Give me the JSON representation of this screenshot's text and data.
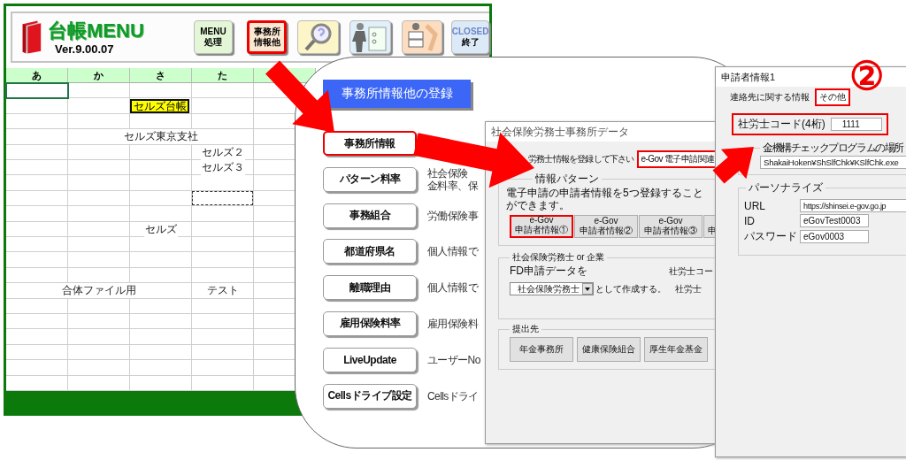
{
  "sheet": {
    "title": "台帳MENU",
    "version": "Ver.9.00.07",
    "toolbar": [
      {
        "kind": "text",
        "lines": [
          "MENU",
          "処理"
        ],
        "selected": false
      },
      {
        "kind": "text",
        "lines": [
          "事務所",
          "情報他"
        ],
        "selected": true
      },
      {
        "kind": "search",
        "selected": false
      },
      {
        "kind": "file",
        "selected": false
      },
      {
        "kind": "tool",
        "selected": false
      },
      {
        "kind": "closed",
        "lines": [
          "CLOSED",
          "終了"
        ],
        "selected": false
      }
    ],
    "columns": [
      "あ",
      "か",
      "さ",
      "た"
    ],
    "rows": [
      {
        "cells": [
          {
            "kind": "active"
          },
          null,
          null,
          null
        ]
      },
      {
        "cells": [
          null,
          null,
          {
            "kind": "highlight",
            "text": "セルズ台帳"
          },
          null
        ]
      },
      {
        "cells": [
          null,
          null,
          null,
          null
        ]
      },
      {
        "cells": [
          null,
          null,
          {
            "kind": "plain",
            "text": "セルズ東京支社"
          },
          null
        ]
      },
      {
        "cells": [
          null,
          null,
          null,
          {
            "kind": "plain",
            "text": "セルズ２"
          }
        ]
      },
      {
        "cells": [
          null,
          null,
          null,
          {
            "kind": "plain",
            "text": "セルズ３"
          }
        ]
      },
      {
        "cells": [
          null,
          null,
          null,
          null
        ]
      },
      {
        "cells": [
          null,
          null,
          null,
          {
            "kind": "marquee"
          }
        ]
      },
      {
        "cells": [
          null,
          null,
          null,
          null
        ]
      },
      {
        "cells": [
          null,
          null,
          {
            "kind": "plain",
            "text": "セルズ"
          },
          null
        ]
      },
      {
        "cells": [
          null,
          null,
          null,
          null
        ]
      },
      {
        "cells": [
          null,
          null,
          null,
          null
        ]
      },
      {
        "cells": [
          null,
          null,
          null,
          null
        ]
      },
      {
        "cells": [
          null,
          {
            "kind": "plain",
            "text": "合体ファイル用"
          },
          null,
          {
            "kind": "plain",
            "text": "テスト"
          }
        ]
      },
      {
        "cells": [
          null,
          null,
          null,
          null
        ]
      },
      {
        "cells": [
          null,
          null,
          null,
          null
        ]
      },
      {
        "cells": [
          null,
          null,
          null,
          null
        ]
      },
      {
        "cells": [
          null,
          null,
          null,
          null
        ]
      },
      {
        "cells": [
          null,
          null,
          null,
          null
        ]
      },
      {
        "cells": [
          null,
          null,
          null,
          null
        ]
      }
    ]
  },
  "registration_panel": {
    "title": "事務所情報他の登録",
    "items": [
      {
        "label": "事務所情報",
        "selected": true
      },
      {
        "label": "パターン料率",
        "selected": false,
        "description": [
          "社会保険",
          "金料率、保"
        ]
      },
      {
        "label": "事務組合",
        "selected": false,
        "description": [
          "労働保険事"
        ]
      },
      {
        "label": "都道府県名",
        "selected": false,
        "description": [
          "個人情報で"
        ]
      },
      {
        "label": "離職理由",
        "selected": false,
        "description": [
          "個人情報で"
        ]
      },
      {
        "label": "雇用保険料率",
        "selected": false,
        "description": [
          "雇用保険料"
        ]
      },
      {
        "label": "LiveUpdate",
        "selected": false,
        "description": [
          "ユーザーNo"
        ]
      },
      {
        "label": "Cellsドライブ設定",
        "selected": false,
        "description": [
          "Cellsドライ"
        ]
      }
    ]
  },
  "office_dialog": {
    "title": "社会保険労務士事務所データ",
    "instruction": "労務士情報を登録して下さい",
    "tab": {
      "label": "e-Gov 電子申請関連",
      "selected": true
    },
    "pattern_group": {
      "legend": "情報パターン",
      "note": "電子申請の申請者情報を5つ登録することができます。",
      "buttons": [
        {
          "lines": [
            "e-Gov",
            "申請者情報①"
          ],
          "selected": true
        },
        {
          "lines": [
            "e-Gov",
            "申請者情報②"
          ],
          "selected": false
        },
        {
          "lines": [
            "e-Gov",
            "申請者情報③"
          ],
          "selected": false
        },
        {
          "lines": [
            "申"
          ],
          "selected": false
        }
      ]
    },
    "maker_group": {
      "legend": "社会保険労務士 or 企業",
      "label": "FD申請データを",
      "select_value": "社会保険労務士",
      "suffix": "として作成する。",
      "code_label": "社労士コー",
      "name_label": "社労士"
    },
    "destination_group": {
      "legend": "提出先",
      "buttons": [
        "年金事務所",
        "健康保険組合",
        "厚生年金基金"
      ]
    }
  },
  "applicant_dialog": {
    "title": "申請者情報1",
    "tabs": [
      {
        "label": "連絡先に関する情報",
        "selected": false
      },
      {
        "label": "その他",
        "selected": true
      }
    ],
    "code": {
      "label": "社労士コード(4桁)",
      "value": "1111"
    },
    "check_group": {
      "legend": "金機構チェックプログラムの場所",
      "path": "ShakaiHoken¥ShSlfChk¥KSlfChk.exe"
    },
    "personalize_group": {
      "legend": "パーソナライズ",
      "fields": [
        {
          "label": "URL",
          "value": "https://shinsei.e-gov.go.jp"
        },
        {
          "label": "ID",
          "value": "eGovTest0003"
        },
        {
          "label": "パスワード",
          "value": "eGov0003"
        }
      ]
    }
  },
  "step_marker": "②"
}
